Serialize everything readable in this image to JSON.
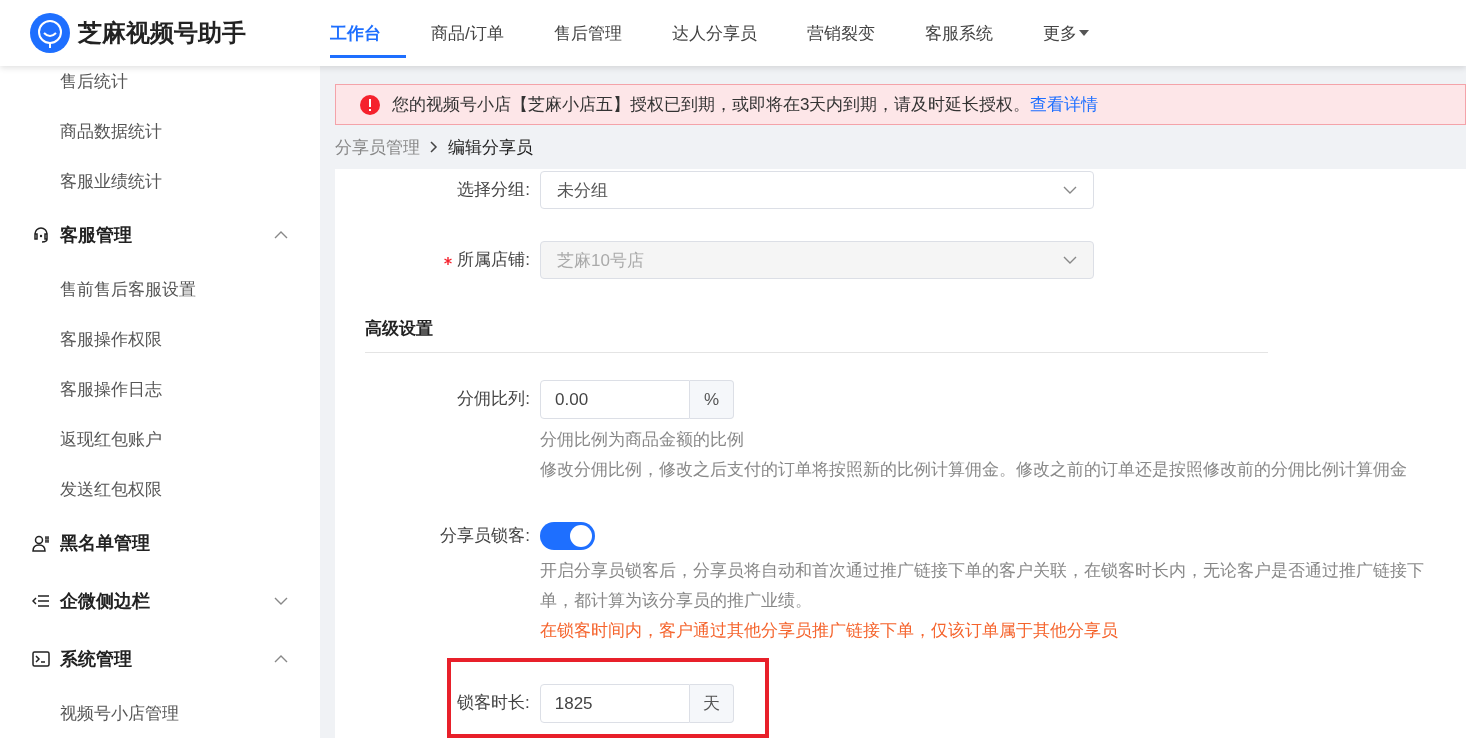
{
  "header": {
    "logo_text": "芝麻视频号助手",
    "tabs": [
      {
        "label": "工作台",
        "selected": true
      },
      {
        "label": "商品/订单",
        "selected": false
      },
      {
        "label": "售后管理",
        "selected": false
      },
      {
        "label": "达人分享员",
        "selected": false
      },
      {
        "label": "营销裂变",
        "selected": false
      },
      {
        "label": "客服系统",
        "selected": false
      },
      {
        "label": "更多",
        "selected": false,
        "dropdown": true
      }
    ]
  },
  "sidebar": {
    "items": [
      {
        "kind": "item",
        "label": "售后统计"
      },
      {
        "kind": "item",
        "label": "商品数据统计"
      },
      {
        "kind": "item",
        "label": "客服业绩统计"
      },
      {
        "kind": "group",
        "label": "客服管理",
        "expanded": true,
        "children": [
          {
            "label": "售前售后客服设置"
          },
          {
            "label": "客服操作权限"
          },
          {
            "label": "客服操作日志"
          },
          {
            "label": "返现红包账户"
          },
          {
            "label": "发送红包权限"
          }
        ]
      },
      {
        "kind": "link",
        "label": "黑名单管理"
      },
      {
        "kind": "group",
        "label": "企微侧边栏",
        "expanded": false
      },
      {
        "kind": "group",
        "label": "系统管理",
        "expanded": true,
        "children": [
          {
            "label": "视频号小店管理"
          }
        ]
      }
    ]
  },
  "alert": {
    "text": "您的视频号小店【芝麻小店五】授权已到期，或即将在3天内到期，请及时延长授权。",
    "link": "查看详情"
  },
  "breadcrumb": [
    {
      "label": "分享员管理"
    },
    {
      "label": "编辑分享员"
    }
  ],
  "form": {
    "rows": [
      {
        "kind": "select",
        "label": "选择分组:",
        "value": "未分组",
        "required": false,
        "disabled": false
      },
      {
        "kind": "select",
        "label": "所属店铺:",
        "value": "芝麻10号店",
        "required": true,
        "disabled": true
      }
    ],
    "section_title": "高级设置",
    "advanced_rows": [
      {
        "kind": "input_addon",
        "label": "分佣比列:",
        "value": "0.00",
        "addon": "%",
        "required": false,
        "highlighted": false,
        "hints": [
          "分佣比例为商品金额的比例",
          "修改分佣比例，修改之后支付的订单将按照新的比例计算佣金。修改之前的订单还是按照修改前的分佣比例计算佣金"
        ]
      },
      {
        "kind": "switch",
        "label": "分享员锁客:",
        "on": true,
        "required": false,
        "hints": [
          "开启分享员锁客后，分享员将自动和首次通过推广链接下单的客户关联，在锁客时长内，无论客户是否通过推广链接下单，都计算为该分享员的推广业绩。"
        ],
        "warning": "在锁客时间内，客户通过其他分享员推广链接下单，仅该订单属于其他分享员"
      },
      {
        "kind": "input_addon",
        "label": "锁客时长:",
        "value": "1825",
        "addon": "天",
        "required": false,
        "highlighted": true,
        "hints": []
      }
    ]
  }
}
